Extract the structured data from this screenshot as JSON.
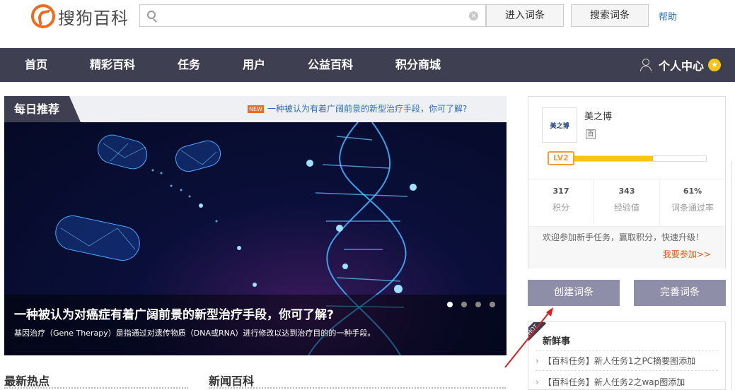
{
  "header": {
    "logo_text": "搜狗百科",
    "search_placeholder": "",
    "enter_button": "进入词条",
    "search_button": "搜索词条",
    "help_link": "帮助"
  },
  "nav": {
    "items": [
      "首页",
      "精彩百科",
      "任务",
      "用户",
      "公益百科",
      "积分商城"
    ],
    "user_center": "个人中心"
  },
  "daily": {
    "tag": "每日推荐",
    "new_badge": "NEW",
    "headline_link": "一种被认为有着广阔前景的新型治疗手段，你可了解?",
    "banner_title": "一种被认为对癌症有着广阔前景的新型治疗手段，你可了解?",
    "banner_desc": "基因治疗（Gene Therapy）是指通过对遗传物质（DNA或RNA）进行修改以达到治疗目的的一种手段。",
    "slide_count": 4,
    "active_slide": 1
  },
  "sections": {
    "hot": "最新热点",
    "news": "新闻百科"
  },
  "profile": {
    "avatar_text": "美之博",
    "username": "美之博",
    "badge": "百",
    "level": "LV2",
    "level_progress": 0.62,
    "stats": [
      {
        "value": "317",
        "label": "积分"
      },
      {
        "value": "343",
        "label": "经验值"
      },
      {
        "value": "61%",
        "label": "词条通过率"
      }
    ],
    "welcome": "欢迎参加新手任务，赢取积分，快速升级！",
    "join_link": "我要参加>>"
  },
  "actions": {
    "create": "创建词条",
    "improve": "完善词条"
  },
  "fresh": {
    "ribbon": "HOT",
    "title": "新鲜事",
    "items": [
      "【百科任务】新人任务1之PC摘要图添加",
      "【百科任务】新人任务2之wap图添加"
    ]
  },
  "colors": {
    "brand_orange": "#f06a1b",
    "nav_bg": "#3f3f52",
    "link_blue": "#2a6ebb",
    "button_purple": "#8e8ea8",
    "level_yellow": "#f5c518"
  }
}
